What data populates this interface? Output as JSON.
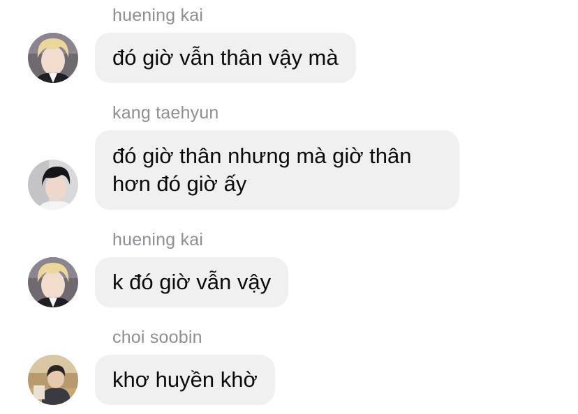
{
  "messages": [
    {
      "sender": "huening kai",
      "text": "đó giờ vẫn thân vậy mà",
      "avatar": "huening-kai-avatar"
    },
    {
      "sender": "kang taehyun",
      "text": "đó giờ thân nhưng mà giờ thân hơn đó giờ ấy",
      "avatar": "kang-taehyun-avatar"
    },
    {
      "sender": "huening kai",
      "text": "k đó giờ vẫn vậy",
      "avatar": "huening-kai-avatar"
    },
    {
      "sender": "choi soobin",
      "text": "khơ huyền khờ",
      "avatar": "choi-soobin-avatar"
    }
  ],
  "colors": {
    "bubble_bg": "#f0f0f0",
    "sender_name": "#8e8e93",
    "message_text": "#0a0a0a"
  }
}
